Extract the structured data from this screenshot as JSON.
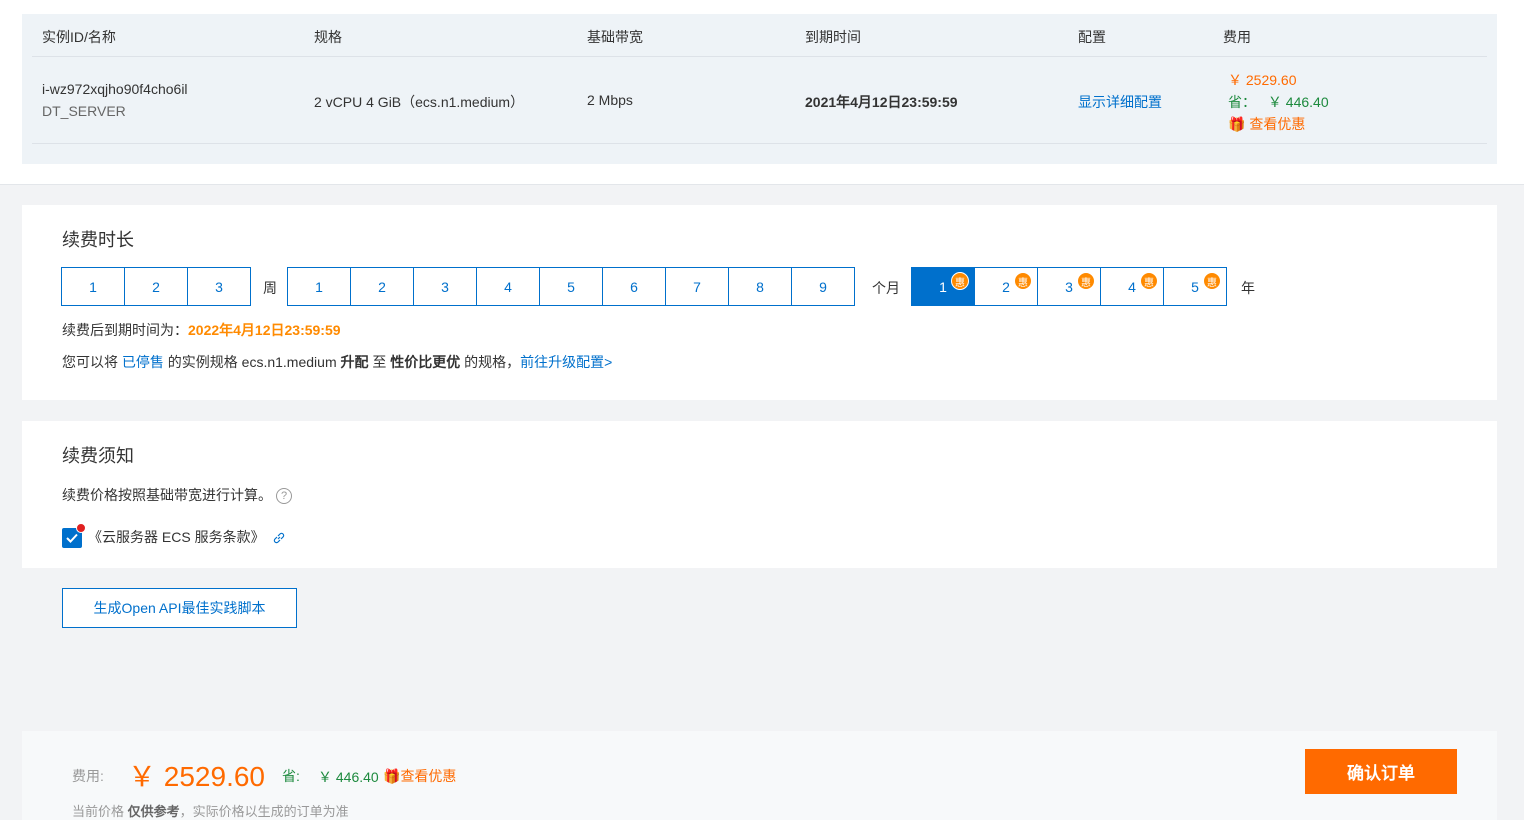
{
  "instance_table": {
    "headers": [
      "实例ID/名称",
      "规格",
      "基础带宽",
      "到期时间",
      "配置",
      "费用"
    ],
    "row": {
      "instance_id": "i-wz972xqjho90f4cho6il",
      "instance_name": "DT_SERVER",
      "spec": "2 vCPU 4 GiB（ecs.n1.medium）",
      "bandwidth": "2 Mbps",
      "expire": "2021年4月12日23:59:59",
      "config_link": "显示详细配置",
      "price": "￥ 2529.60",
      "save_label": "省：",
      "save_value": "￥ 446.40",
      "discount_link": "查看优惠"
    }
  },
  "renew": {
    "title": "续费时长",
    "week_options": [
      "1",
      "2",
      "3"
    ],
    "week_unit": "周",
    "month_options": [
      "1",
      "2",
      "3",
      "4",
      "5",
      "6",
      "7",
      "8",
      "9"
    ],
    "month_unit": "个月",
    "year_options": [
      "1",
      "2",
      "3",
      "4",
      "5"
    ],
    "year_badge": "惠",
    "year_unit": "年",
    "selected": "1年",
    "expire_label": "续费后到期时间为：",
    "expire_value": "2022年4月12日23:59:59",
    "upgrade": {
      "p1": "您可以将",
      "stopped": "已停售",
      "p2": "的实例规格 ecs.n1.medium",
      "upgrade": "升配",
      "p3": "至",
      "better": "性价比更优",
      "p4": "的规格，",
      "link": "前往升级配置>"
    }
  },
  "notice": {
    "title": "续费须知",
    "text": "续费价格按照基础带宽进行计算。",
    "help": "?",
    "terms": "《云服务器 ECS 服务条款》",
    "terms_checked": true
  },
  "api_button": "生成Open API最佳实践脚本",
  "footer": {
    "fee_label": "费用:",
    "fee_value": "￥ 2529.60",
    "save_label": "省:",
    "save_value": "￥ 446.40",
    "discount_link": "查看优惠",
    "note_p1": "当前价格",
    "note_bold": "仅供参考",
    "note_p2": "，实际价格以生成的订单为准",
    "confirm": "确认订单"
  },
  "colors": {
    "primary": "#0070cc",
    "accent": "#ff6a00",
    "save": "#1d8a3e",
    "badge": "#ff8a00"
  }
}
